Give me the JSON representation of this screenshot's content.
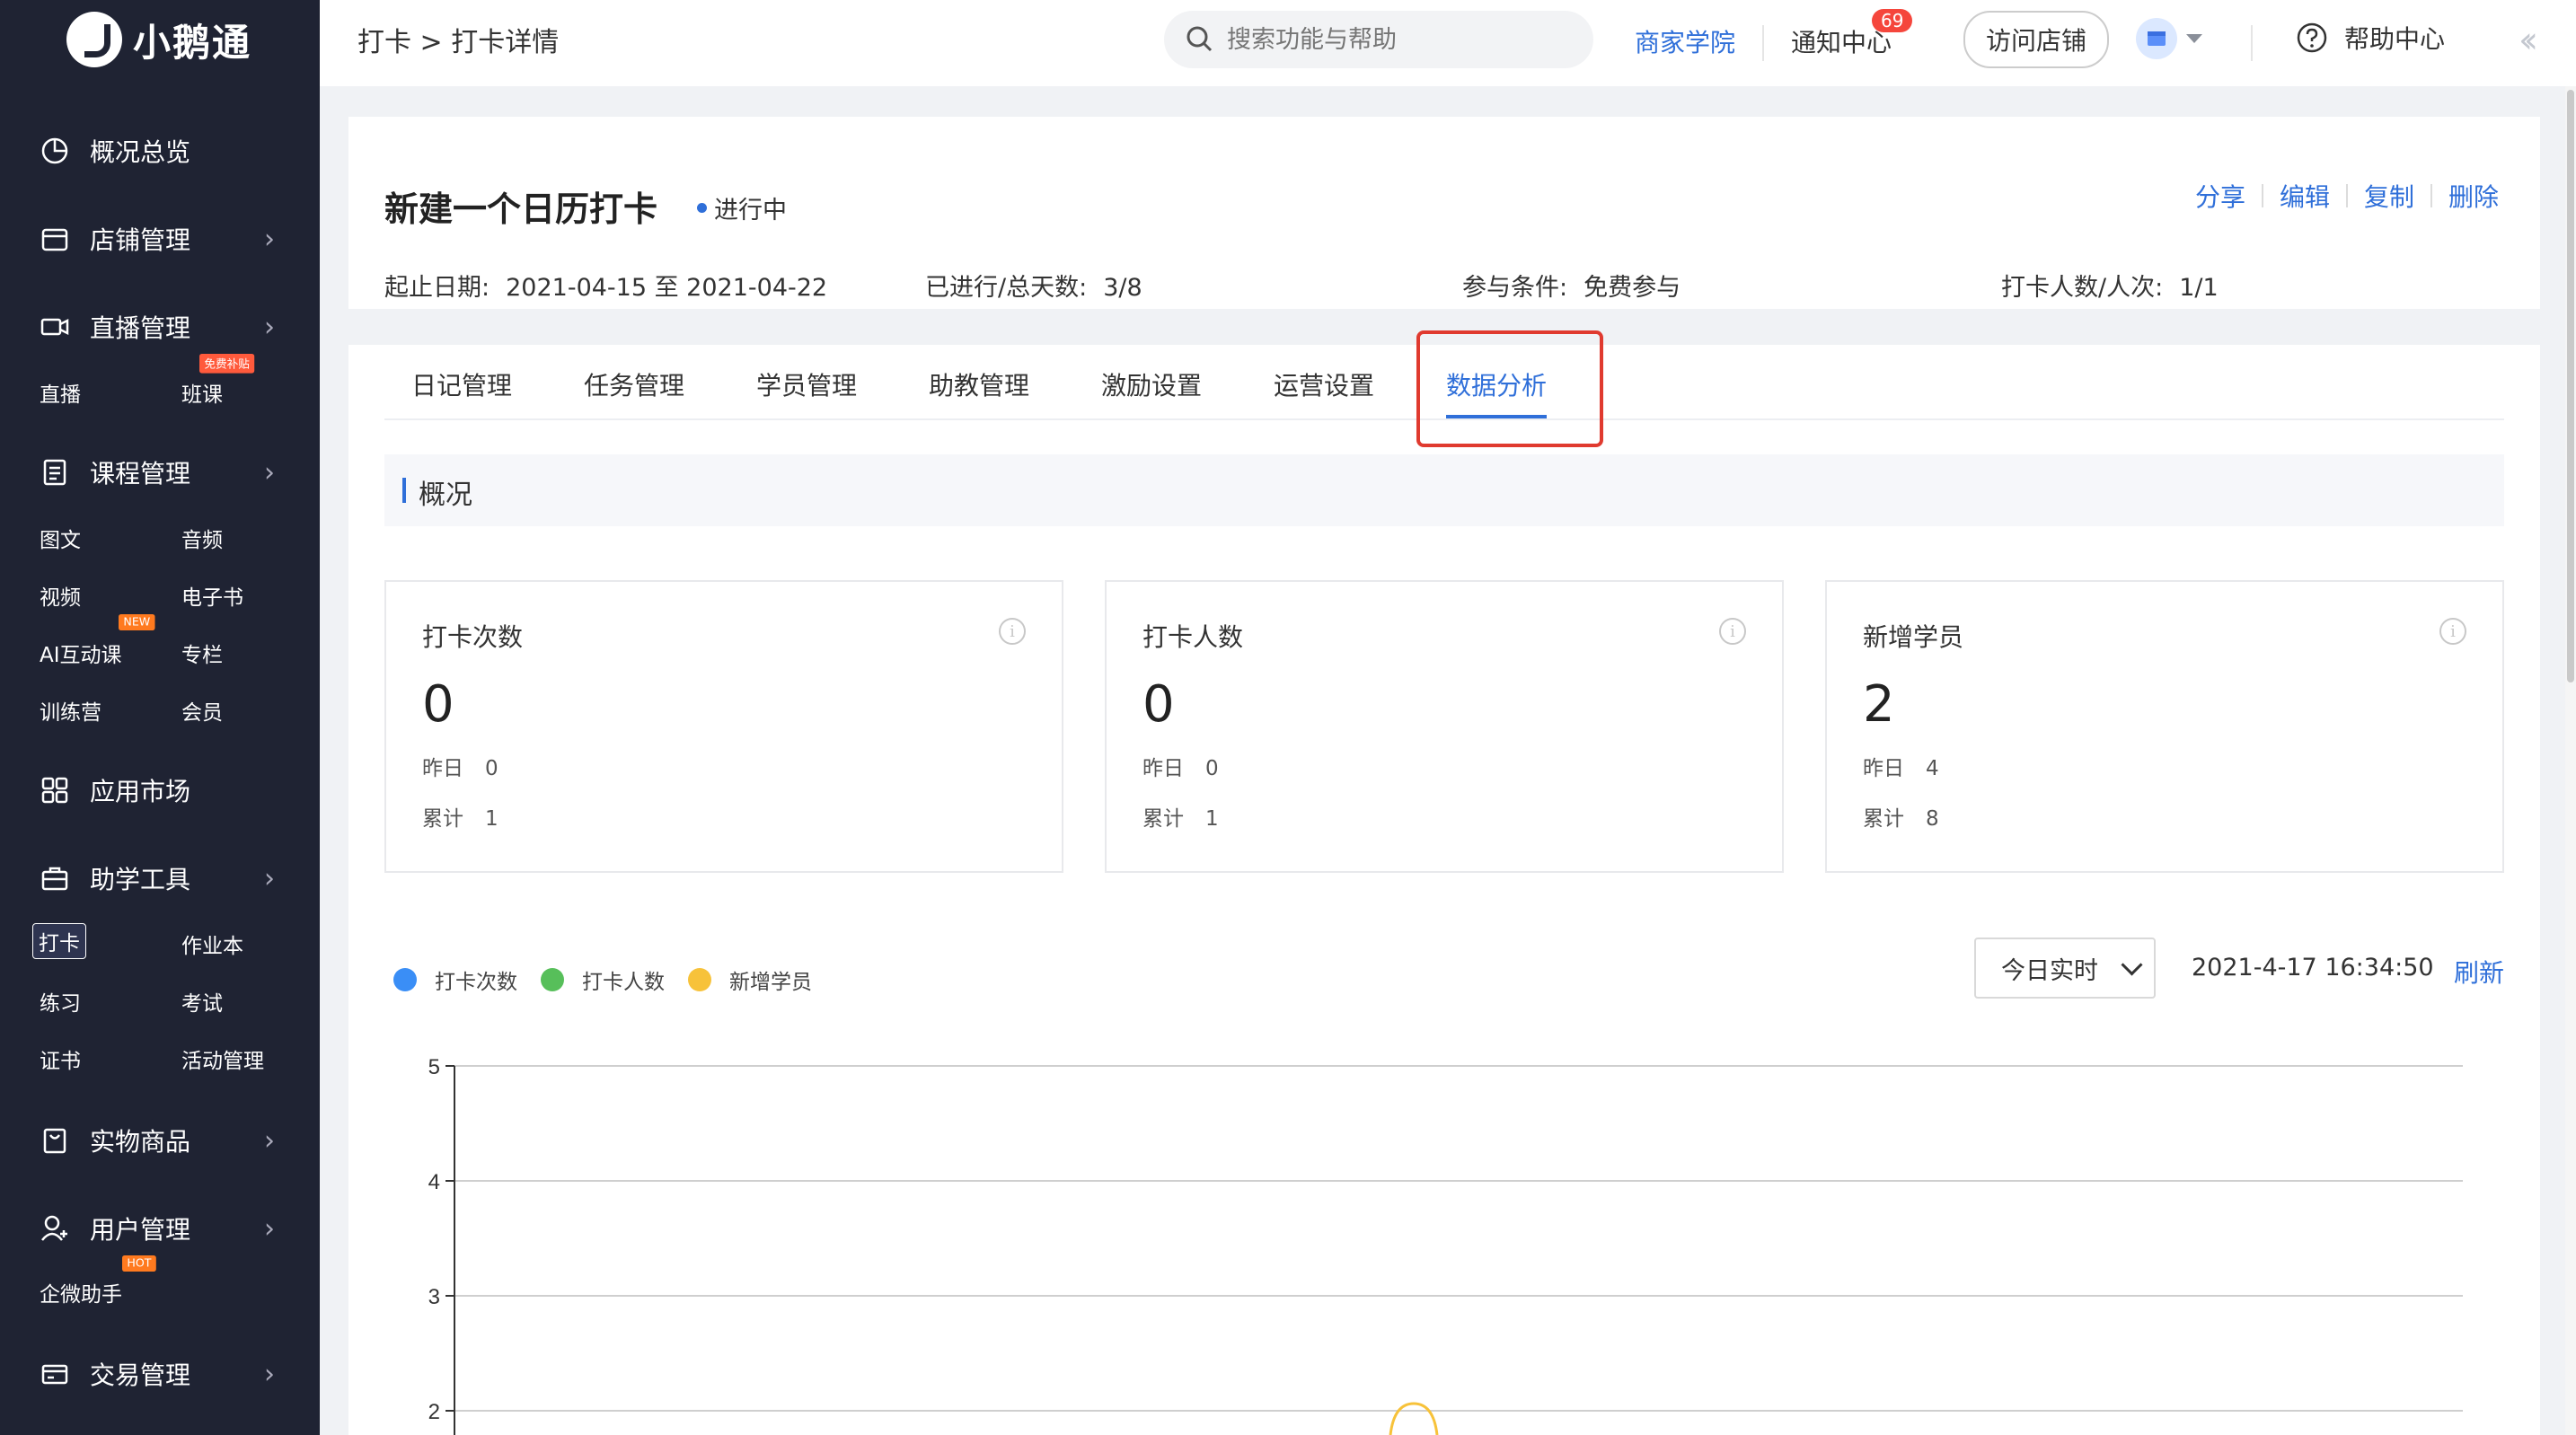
{
  "sidebar": {
    "brand": "小鹅通",
    "items": [
      {
        "label": "概况总览",
        "icon": "pie-chart-icon",
        "has_chevron": false
      },
      {
        "label": "店铺管理",
        "icon": "store-icon",
        "has_chevron": true
      },
      {
        "label": "直播管理",
        "icon": "video-camera-icon",
        "has_chevron": true
      },
      {
        "label": "课程管理",
        "icon": "document-icon",
        "has_chevron": true
      },
      {
        "label": "应用市场",
        "icon": "apps-grid-icon",
        "has_chevron": false
      },
      {
        "label": "助学工具",
        "icon": "toolbox-icon",
        "has_chevron": true
      },
      {
        "label": "实物商品",
        "icon": "shopping-bag-icon",
        "has_chevron": true
      },
      {
        "label": "用户管理",
        "icon": "user-icon",
        "has_chevron": true
      },
      {
        "label": "交易管理",
        "icon": "card-icon",
        "has_chevron": true
      }
    ],
    "live_sub": [
      "直播",
      "班课"
    ],
    "live_tag": "免费补贴",
    "course_sub": [
      "图文",
      "音频",
      "视频",
      "电子书",
      "AI互动课",
      "专栏",
      "训练营",
      "会员"
    ],
    "course_tag": "NEW",
    "tools_sub": [
      "打卡",
      "作业本",
      "练习",
      "考试",
      "证书",
      "活动管理"
    ],
    "tools_active": "打卡",
    "user_sub": [
      "企微助手"
    ],
    "user_tag": "HOT"
  },
  "topbar": {
    "breadcrumb": "打卡 > 打卡详情",
    "search_placeholder": "搜索功能与帮助",
    "academy": "商家学院",
    "notice": "通知中心",
    "notice_count": "69",
    "visit_store": "访问店铺",
    "help": "帮助中心"
  },
  "header": {
    "title": "新建一个日历打卡",
    "status": "进行中",
    "actions": [
      "分享",
      "编辑",
      "复制",
      "删除"
    ],
    "info": [
      {
        "key": "起止日期:",
        "value": "2021-04-15 至 2021-04-22"
      },
      {
        "key": "已进行/总天数:",
        "value": "3/8"
      },
      {
        "key": "参与条件:",
        "value": "免费参与"
      },
      {
        "key": "打卡人数/人次:",
        "value": "1/1"
      }
    ]
  },
  "tabs": [
    "日记管理",
    "任务管理",
    "学员管理",
    "助教管理",
    "激励设置",
    "运营设置",
    "数据分析"
  ],
  "active_tab": "数据分析",
  "overview": {
    "title": "概况",
    "cards": [
      {
        "label": "打卡次数",
        "value": "0",
        "yesterday_label": "昨日",
        "yesterday": "0",
        "total_label": "累计",
        "total": "1"
      },
      {
        "label": "打卡人数",
        "value": "0",
        "yesterday_label": "昨日",
        "yesterday": "0",
        "total_label": "累计",
        "total": "1"
      },
      {
        "label": "新增学员",
        "value": "2",
        "yesterday_label": "昨日",
        "yesterday": "4",
        "total_label": "累计",
        "total": "8"
      }
    ]
  },
  "chart_controls": {
    "range_select": "今日实时",
    "timestamp": "2021-4-17 16:34:50",
    "refresh": "刷新"
  },
  "colors": {
    "accent": "#2f6fd9",
    "sidebar_bg": "#1f2333",
    "highlight": "#e03a2f"
  },
  "chart_data": {
    "type": "line",
    "series": [
      {
        "name": "打卡次数",
        "color": "#3a8ef6",
        "values": []
      },
      {
        "name": "打卡人数",
        "color": "#57bf5a",
        "values": []
      },
      {
        "name": "新增学员",
        "color": "#f7c23a",
        "values": []
      }
    ],
    "yticks": [
      2,
      3,
      4,
      5
    ],
    "ylim_visible": [
      2,
      5
    ],
    "legend_position": "top-left",
    "grid": true
  }
}
